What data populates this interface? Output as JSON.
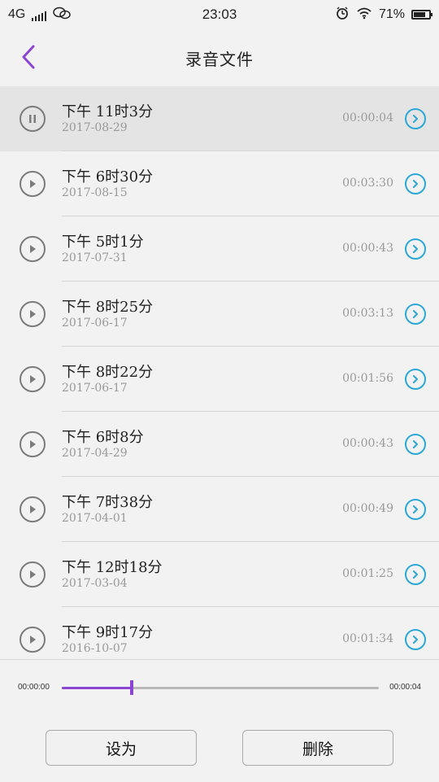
{
  "status": {
    "network": "4G",
    "time": "23:03",
    "battery": "71%",
    "icons": [
      "signal-icon",
      "wechat-icon",
      "alarm-icon",
      "wifi-icon",
      "battery-icon"
    ]
  },
  "header": {
    "title": "录音文件"
  },
  "recordings": [
    {
      "title": "下午 11时3分",
      "date": "2017-08-29",
      "duration": "00:00:04",
      "state": "pause"
    },
    {
      "title": "下午 6时30分",
      "date": "2017-08-15",
      "duration": "00:03:30",
      "state": "play"
    },
    {
      "title": "下午 5时1分",
      "date": "2017-07-31",
      "duration": "00:00:43",
      "state": "play"
    },
    {
      "title": "下午 8时25分",
      "date": "2017-06-17",
      "duration": "00:03:13",
      "state": "play"
    },
    {
      "title": "下午 8时22分",
      "date": "2017-06-17",
      "duration": "00:01:56",
      "state": "play"
    },
    {
      "title": "下午 6时8分",
      "date": "2017-04-29",
      "duration": "00:00:43",
      "state": "play"
    },
    {
      "title": "下午 7时38分",
      "date": "2017-04-01",
      "duration": "00:00:49",
      "state": "play"
    },
    {
      "title": "下午 12时18分",
      "date": "2017-03-04",
      "duration": "00:01:25",
      "state": "play"
    },
    {
      "title": "下午 9时17分",
      "date": "2016-10-07",
      "duration": "00:01:34",
      "state": "play"
    }
  ],
  "player": {
    "start_time": "00:00:00",
    "end_time": "00:00:04",
    "progress": 0.22
  },
  "actions": {
    "set_as": "设为",
    "delete": "删除"
  },
  "colors": {
    "accent": "#8c45d3",
    "detail": "#2aa8d6",
    "muted": "#9a9a9a"
  }
}
